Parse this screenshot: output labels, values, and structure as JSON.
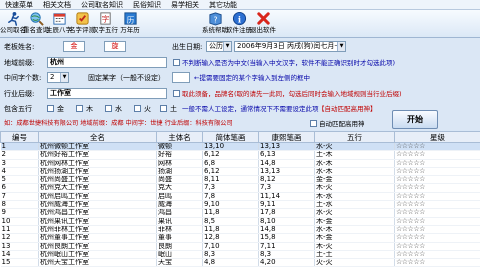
{
  "menu": [
    "快速菜单",
    "相关文档",
    "公司取名知识",
    "民俗知识",
    "易学相关",
    "其它功能"
  ],
  "toolbar": [
    {
      "label": "公司取名",
      "icon": "runner-icon"
    },
    {
      "label": "重名查询",
      "icon": "search-globe-icon"
    },
    {
      "label": "生辰八字",
      "icon": "calendar-icon"
    },
    {
      "label": "名字评测",
      "icon": "evaluate-icon"
    },
    {
      "label": "汉字五行",
      "icon": "five-elements-icon"
    },
    {
      "label": "万年历",
      "icon": "almanac-icon"
    },
    {
      "label": "系统帮助",
      "icon": "help-icon"
    },
    {
      "label": "软件注册",
      "icon": "info-icon"
    },
    {
      "label": "退出软件",
      "icon": "exit-icon"
    }
  ],
  "form": {
    "boss_label": "老板姓名:",
    "surname": "金",
    "given": "旋",
    "birth_label": "出生日期:",
    "calendar_type": "公历",
    "birth_date": "2006年9月3日 丙戌(狗)闰七月十一",
    "region_label": "地域前缀:",
    "region": "杭州",
    "region_note": "不判断输入是否为中文(当输入中文汉字，软件不能正确识别时才勾选此项)",
    "charcount_label": "中间字个数:",
    "charcount": "2",
    "fixed_label": "固定某字（一般不设定）",
    "fixed_note": "←提需要固定的某个字输入到左侧的框中",
    "industry_label": "行业后缀:",
    "industry": "工作室",
    "industry_check_note": "取此须备，品牌名(取的请先一此同，勾选后同时会输入地域规则当行业后缀)",
    "wuxing_label": "包含五行",
    "wuxing": [
      "金",
      "木",
      "水",
      "火",
      "土"
    ],
    "wuxing_hint": "一般不需人工设定，通常情况下不需要设定此项",
    "auto_config": "【自动匹配高用神】",
    "example": "如：成都世捷科技有限公司    地域前缀：成都    中间字：世捷    行业后缀：科技有限公司",
    "auto_check": "自动匹配高用神",
    "start_button": "开始"
  },
  "table": {
    "columns": [
      "编号",
      "全名",
      "主体名",
      "简体笔画",
      "康熙笔画",
      "五行",
      "星级"
    ],
    "rows": [
      [
        "1",
        "杭州微顿工作室",
        "微顿",
        "13,10",
        "13,13",
        "水-火",
        "☆☆☆☆☆"
      ],
      [
        "2",
        "杭州好裕工作室",
        "好裕",
        "6,12",
        "6,13",
        "土-木",
        "☆☆☆☆☆"
      ],
      [
        "3",
        "杭州网林工作室",
        "网林",
        "6,8",
        "14,8",
        "水-木",
        "☆☆☆☆☆"
      ],
      [
        "4",
        "杭州扬湖工作室",
        "扬湖",
        "6,12",
        "13,13",
        "水-木",
        "☆☆☆☆☆"
      ],
      [
        "5",
        "杭州尚盛工作室",
        "尚盛",
        "8,11",
        "8,12",
        "金-金",
        "☆☆☆☆☆"
      ],
      [
        "6",
        "杭州克大工作室",
        "克大",
        "7,3",
        "7,3",
        "木-火",
        "☆☆☆☆☆"
      ],
      [
        "7",
        "杭州启鸣工作室",
        "启鸣",
        "7,8",
        "11,14",
        "木-水",
        "☆☆☆☆☆"
      ],
      [
        "8",
        "杭州威海工作室",
        "威海",
        "9,10",
        "9,11",
        "土-水",
        "☆☆☆☆☆"
      ],
      [
        "9",
        "杭州鸿昌工作室",
        "鸿昌",
        "11,8",
        "17,8",
        "水-火",
        "☆☆☆☆☆"
      ],
      [
        "10",
        "杭州果讯工作室",
        "果讯",
        "8,5",
        "8,10",
        "木-金",
        "☆☆☆☆☆"
      ],
      [
        "11",
        "杭州菲林工作室",
        "菲林",
        "11,8",
        "14,8",
        "水-木",
        "☆☆☆☆☆"
      ],
      [
        "12",
        "杭州董事工作室",
        "董事",
        "12,8",
        "15,8",
        "木-金",
        "☆☆☆☆☆"
      ],
      [
        "13",
        "杭州良朗工作室",
        "良朗",
        "7,10",
        "7,11",
        "木-火",
        "☆☆☆☆☆"
      ],
      [
        "14",
        "杭州岷山工作室",
        "岷山",
        "8,3",
        "8,3",
        "土-土",
        "☆☆☆☆☆"
      ],
      [
        "15",
        "杭州天宝工作室",
        "天宝",
        "4,8",
        "4,20",
        "火-火",
        "☆☆☆☆☆"
      ]
    ]
  },
  "colors": {
    "accent": "#1f4f8f",
    "header_bg": "#e7eef8",
    "panel_bg": "#dbe7f5",
    "selected_row": "#cfe0f5"
  }
}
